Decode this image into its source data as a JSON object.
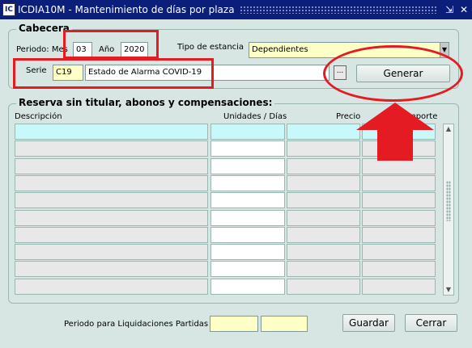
{
  "window": {
    "title": "ICDIA10M - Mantenimiento de días por plaza",
    "icon": "app-icon",
    "title_icon_text": "IC",
    "minimize_glyph": "⇲",
    "close_glyph": "✕"
  },
  "cabecera": {
    "title": "Cabecera",
    "periodo_label": "Periodo: Mes",
    "mes_value": "03",
    "anio_label": "Año",
    "anio_value": "2020",
    "tipo_estancia_label": "Tipo de estancia",
    "tipo_estancia_value": "Dependientes",
    "serie_label": "Serie",
    "serie_code": "C19",
    "serie_description": "Estado de Alarma COVID-19",
    "lov_glyph": "...",
    "generar_label": "Generar"
  },
  "reserva": {
    "title": "Reserva sin titular, abonos y compensaciones:",
    "columns": [
      "Descripción",
      "Unidades / Días",
      "Precio",
      "Importe"
    ],
    "rows": [
      [
        "",
        "",
        "",
        ""
      ],
      [
        "",
        "",
        "",
        ""
      ],
      [
        "",
        "",
        "",
        ""
      ],
      [
        "",
        "",
        "",
        ""
      ],
      [
        "",
        "",
        "",
        ""
      ],
      [
        "",
        "",
        "",
        ""
      ],
      [
        "",
        "",
        "",
        ""
      ],
      [
        "",
        "",
        "",
        ""
      ],
      [
        "",
        "",
        "",
        ""
      ],
      [
        "",
        "",
        "",
        ""
      ]
    ]
  },
  "footer": {
    "periodo_liq_label": "Periodo para Liquidaciones Partidas",
    "periodo_liq_from": "",
    "periodo_liq_to": "",
    "guardar_label": "Guardar",
    "cerrar_label": "Cerrar"
  },
  "annotations": {
    "color": "#e51b24"
  }
}
